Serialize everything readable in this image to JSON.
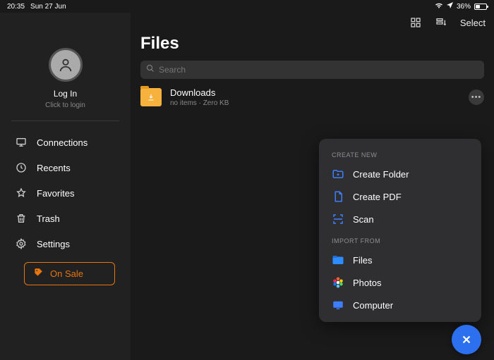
{
  "status": {
    "time": "20:35",
    "date": "Sun 27 Jun",
    "battery": "36%"
  },
  "sidebar": {
    "login_label": "Log In",
    "login_sub": "Click to login",
    "items": [
      {
        "label": "Connections"
      },
      {
        "label": "Recents"
      },
      {
        "label": "Favorites"
      },
      {
        "label": "Trash"
      },
      {
        "label": "Settings"
      }
    ],
    "sale_label": "On Sale"
  },
  "toolbar": {
    "select": "Select"
  },
  "page": {
    "title": "Files",
    "search_placeholder": "Search"
  },
  "folder": {
    "name": "Downloads",
    "meta_items": "no items",
    "meta_size": "Zero KB"
  },
  "popup": {
    "create_hdr": "CREATE NEW",
    "create": [
      {
        "label": "Create Folder"
      },
      {
        "label": "Create PDF"
      },
      {
        "label": "Scan"
      }
    ],
    "import_hdr": "IMPORT FROM",
    "import": [
      {
        "label": "Files"
      },
      {
        "label": "Photos"
      },
      {
        "label": "Computer"
      }
    ]
  }
}
